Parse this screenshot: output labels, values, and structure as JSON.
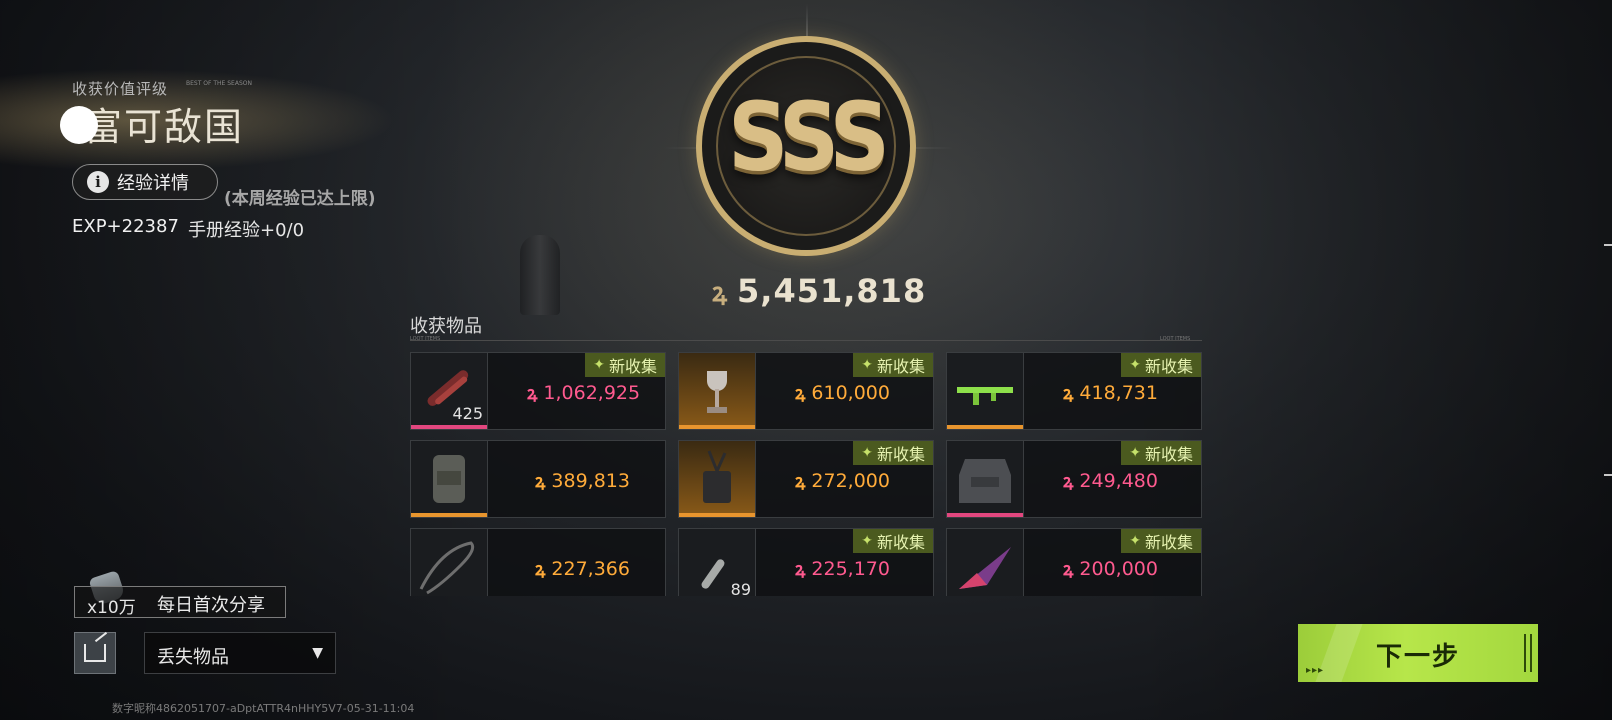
{
  "header": {
    "rank_caption": "收获价值评级",
    "rank_caption_sub": "BEST OF THE SEASON",
    "rank_title": "富可敌国",
    "exp_button_label": "经验详情",
    "exp_limit_note": "(本周经验已达上限)",
    "exp_value": "EXP+22387",
    "manual_exp": "手册经验+0/0"
  },
  "badge": {
    "grade": "SSS",
    "total_value": "5,451,818"
  },
  "items_section": {
    "title": "收获物品",
    "subtitle": "LOOT ITEMS",
    "new_label": "新收集",
    "items": [
      {
        "name": "red-ammo",
        "price": "1,062,925",
        "rarity": "pink",
        "qty": "425",
        "is_new": true
      },
      {
        "name": "trophy",
        "price": "610,000",
        "rarity": "orange",
        "qty": "",
        "is_new": true
      },
      {
        "name": "green-rifle",
        "price": "418,731",
        "rarity": "orange",
        "qty": "",
        "is_new": true
      },
      {
        "name": "backpack",
        "price": "389,813",
        "rarity": "orange",
        "qty": "",
        "is_new": false
      },
      {
        "name": "device",
        "price": "272,000",
        "rarity": "orange",
        "qty": "",
        "is_new": true
      },
      {
        "name": "armor-vest",
        "price": "249,480",
        "rarity": "pink",
        "qty": "",
        "is_new": true
      },
      {
        "name": "cable",
        "price": "227,366",
        "rarity": "orange",
        "qty": "",
        "is_new": false
      },
      {
        "name": "ammo-round",
        "price": "225,170",
        "rarity": "pink",
        "qty": "89",
        "is_new": true
      },
      {
        "name": "crystal-shard",
        "price": "200,000",
        "rarity": "pink",
        "qty": "",
        "is_new": true
      }
    ]
  },
  "share": {
    "multiplier": "x10万",
    "label": "每日首次分享"
  },
  "lost_items": {
    "label": "丢失物品"
  },
  "next_button": {
    "label": "下一步",
    "dots": "▸▸▸"
  },
  "footer": {
    "id_text": "数字昵称4862051707-aDptATTR4nHHY5V7-05-31-11:04"
  },
  "colors": {
    "pink": "#ff5a8f",
    "orange": "#ffab3a",
    "accent_green": "#b7e64a",
    "gold": "#d9be86"
  },
  "icons": {
    "coin": "currency-coin-icon",
    "info": "info-icon",
    "share": "share-icon",
    "new": "sparkle-icon",
    "dropdown": "triangle-down-icon"
  }
}
